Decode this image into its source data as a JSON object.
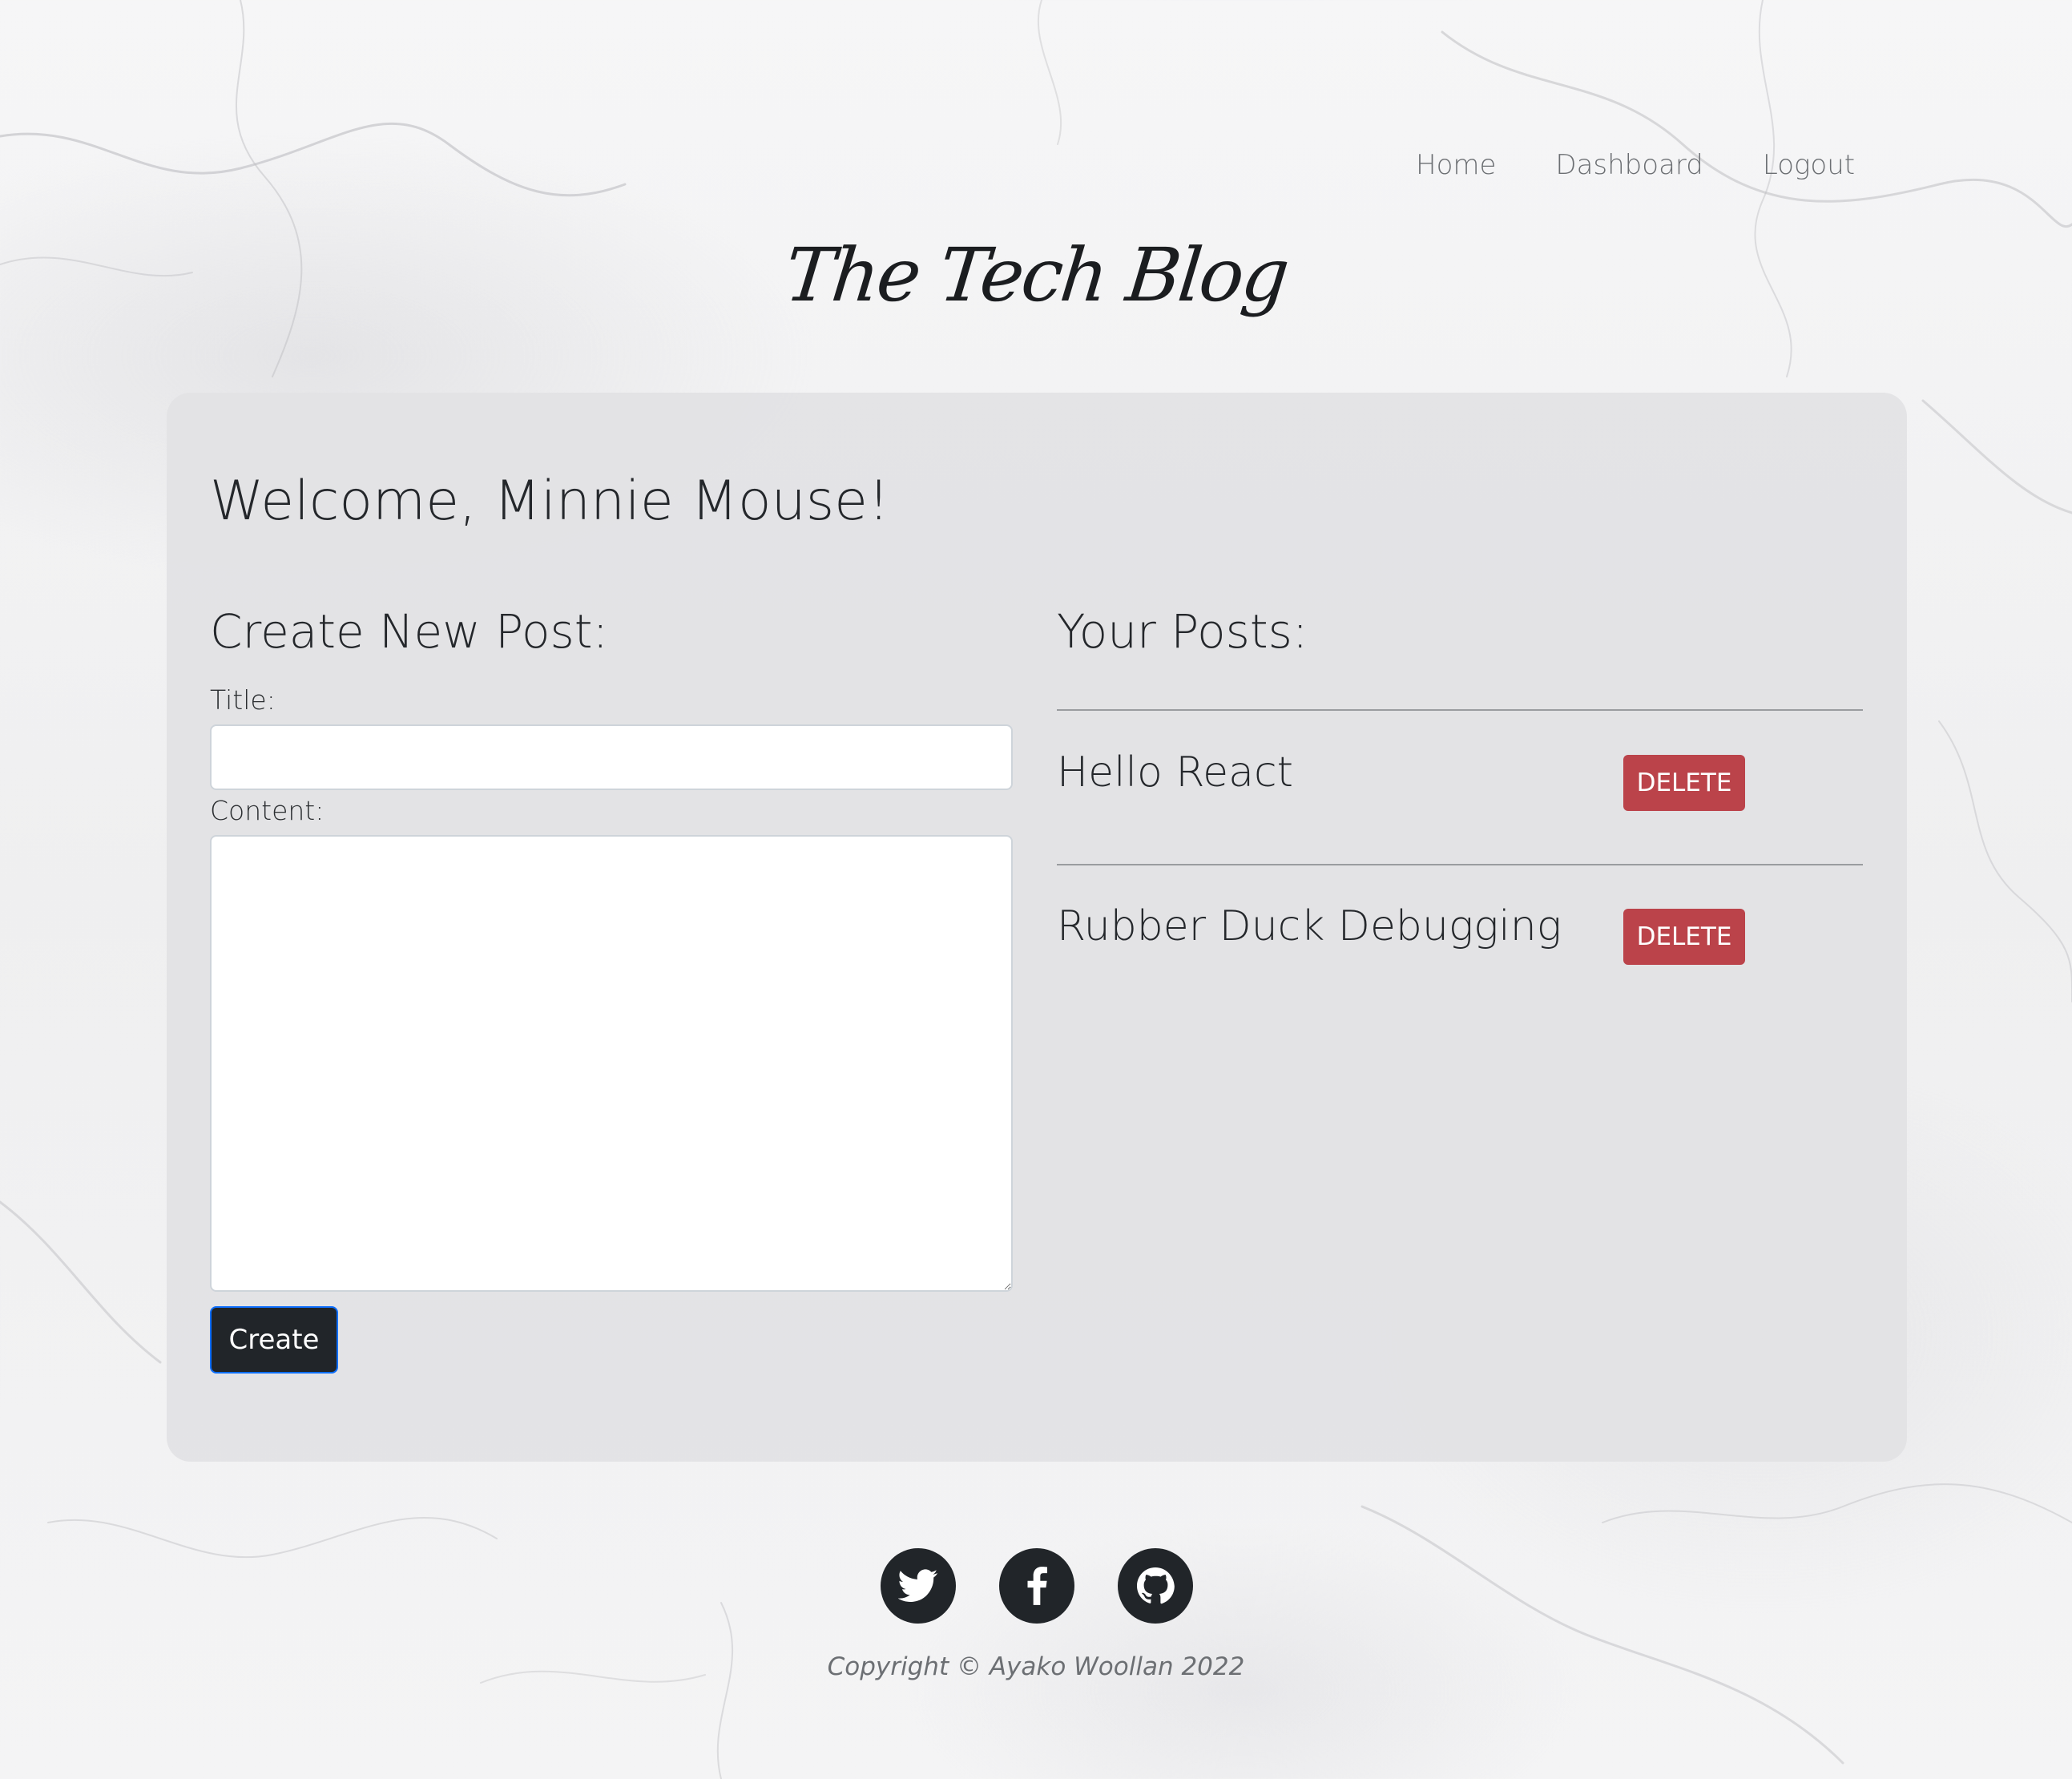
{
  "nav": {
    "home": "Home",
    "dashboard": "Dashboard",
    "logout": "Logout"
  },
  "brand": "The Tech Blog",
  "welcome": "Welcome, Minnie Mouse!",
  "create_post": {
    "heading": "Create New Post:",
    "title_label": "Title:",
    "title_value": "",
    "content_label": "Content:",
    "content_value": "",
    "submit_label": "Create"
  },
  "your_posts": {
    "heading": "Your Posts:",
    "posts": [
      {
        "title": "Hello React",
        "delete_label": "DELETE"
      },
      {
        "title": "Rubber Duck Debugging",
        "delete_label": "DELETE"
      }
    ]
  },
  "footer": {
    "social_icons": [
      "twitter-icon",
      "facebook-icon",
      "github-icon"
    ],
    "copyright": "Copyright © Ayako Woollan 2022"
  },
  "colors": {
    "primary_dark": "#212529",
    "delete_red": "#bb434a",
    "focus_blue": "#0d6efd"
  }
}
